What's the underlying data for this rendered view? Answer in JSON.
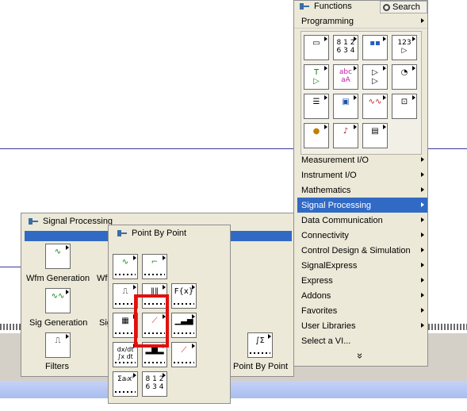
{
  "functions_palette": {
    "title": "Functions",
    "search_label": "Search",
    "section_header": "Programming",
    "menu_items": [
      {
        "label": "Measurement I/O",
        "has_submenu": true,
        "selected": false
      },
      {
        "label": "Instrument I/O",
        "has_submenu": true,
        "selected": false
      },
      {
        "label": "Mathematics",
        "has_submenu": true,
        "selected": false
      },
      {
        "label": "Signal Processing",
        "has_submenu": true,
        "selected": true
      },
      {
        "label": "Data Communication",
        "has_submenu": true,
        "selected": false
      },
      {
        "label": "Connectivity",
        "has_submenu": true,
        "selected": false
      },
      {
        "label": "Control Design & Simulation",
        "has_submenu": true,
        "selected": false
      },
      {
        "label": "SignalExpress",
        "has_submenu": true,
        "selected": false
      },
      {
        "label": "Express",
        "has_submenu": true,
        "selected": false
      },
      {
        "label": "Addons",
        "has_submenu": true,
        "selected": false
      },
      {
        "label": "Favorites",
        "has_submenu": true,
        "selected": false
      },
      {
        "label": "User Libraries",
        "has_submenu": true,
        "selected": false
      },
      {
        "label": "Select a VI...",
        "has_submenu": false,
        "selected": false
      }
    ],
    "more_label": "»"
  },
  "signal_processing_palette": {
    "title": "Signal Processing",
    "items": [
      {
        "label": "Wfm Generation",
        "icon": "waveform-generation-icon"
      },
      {
        "label": "Wf",
        "icon": "waveform-conditioning-icon"
      },
      {
        "label": "Sig Generation",
        "icon": "signal-generation-icon"
      },
      {
        "label": "Sig",
        "icon": "signal-operation-icon"
      },
      {
        "label": "Filters",
        "icon": "filters-icon"
      }
    ]
  },
  "point_by_point_palette": {
    "title": "Point By Point",
    "item_label": "Point By Point"
  },
  "colors": {
    "palette_bg": "#ece9d8",
    "selection": "#316ac5",
    "highlight": "#e01010"
  }
}
